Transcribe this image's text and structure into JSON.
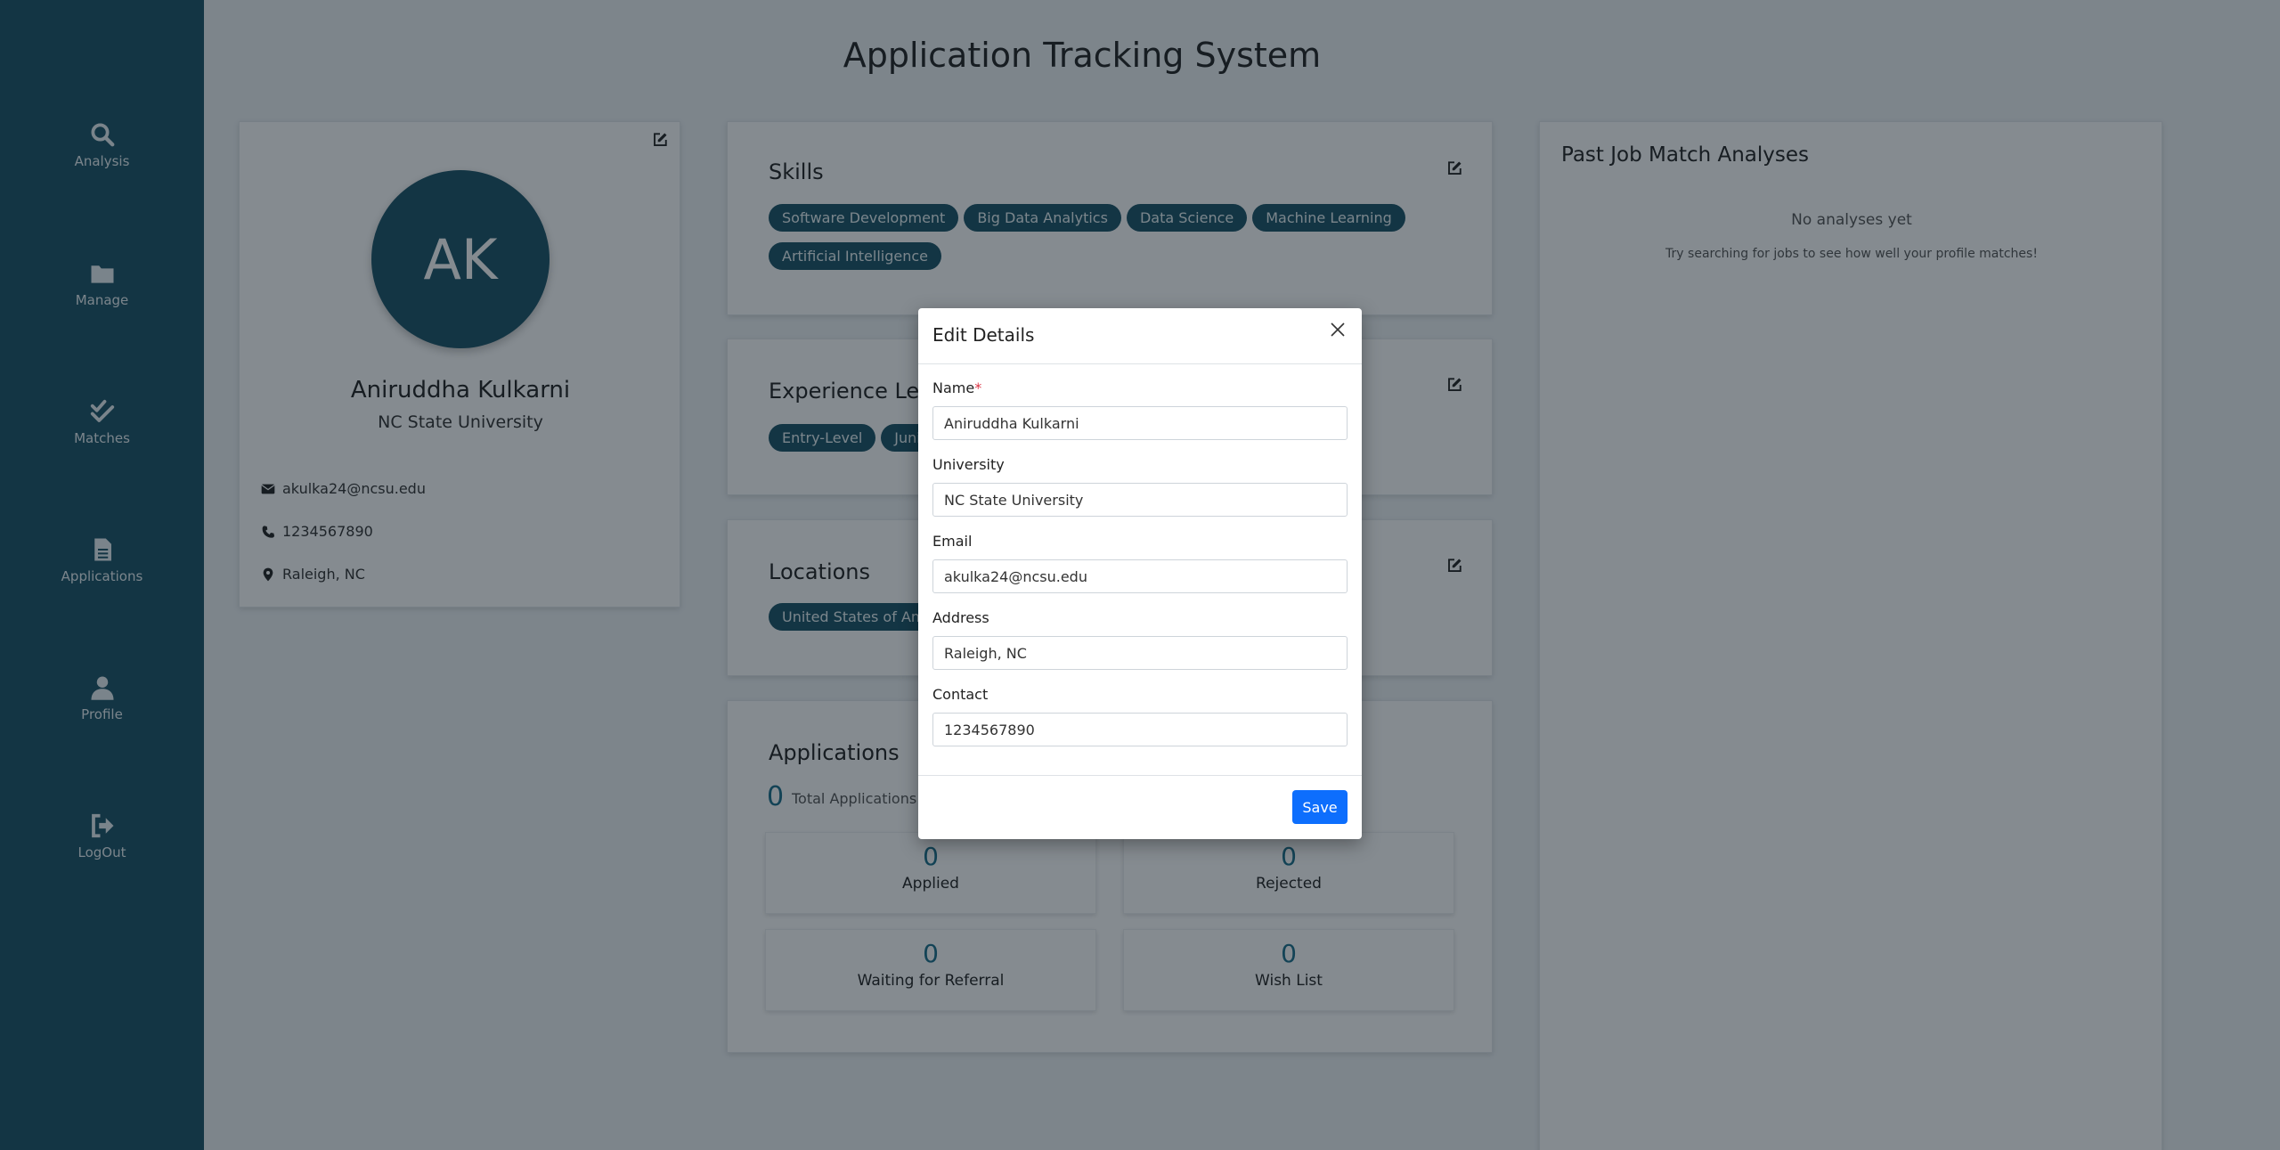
{
  "app_title": "Application Tracking System",
  "sidebar": {
    "items": [
      {
        "label": "Analysis",
        "icon": "search-icon"
      },
      {
        "label": "Manage",
        "icon": "folder-icon"
      },
      {
        "label": "Matches",
        "icon": "double-check-icon"
      },
      {
        "label": "Applications",
        "icon": "document-icon"
      },
      {
        "label": "Profile",
        "icon": "user-icon"
      },
      {
        "label": "LogOut",
        "icon": "logout-icon"
      }
    ]
  },
  "profile": {
    "initials": "AK",
    "name": "Aniruddha Kulkarni",
    "university": "NC State University",
    "email": "akulka24@ncsu.edu",
    "phone": "1234567890",
    "location": "Raleigh, NC"
  },
  "skills": {
    "title": "Skills",
    "items": [
      "Software Development",
      "Big Data Analytics",
      "Data Science",
      "Machine Learning",
      "Artificial Intelligence"
    ]
  },
  "experience": {
    "title": "Experience Level",
    "items": [
      "Entry-Level",
      "Junior-Level"
    ]
  },
  "locations": {
    "title": "Locations",
    "items": [
      "United States of America"
    ]
  },
  "applications": {
    "title": "Applications",
    "total": "0",
    "total_label": "Total Applications",
    "stats": [
      {
        "value": "0",
        "label": "Applied"
      },
      {
        "value": "0",
        "label": "Rejected"
      },
      {
        "value": "0",
        "label": "Waiting for Referral"
      },
      {
        "value": "0",
        "label": "Wish List"
      }
    ]
  },
  "past_analyses": {
    "title": "Past Job Match Analyses",
    "empty": "No analyses yet",
    "hint": "Try searching for jobs to see how well your profile matches!"
  },
  "modal": {
    "title": "Edit Details",
    "required_mark": "*",
    "fields": [
      {
        "label": "Name",
        "value": "Aniruddha Kulkarni"
      },
      {
        "label": "University",
        "value": "NC State University"
      },
      {
        "label": "Email",
        "value": "akulka24@ncsu.edu"
      },
      {
        "label": "Address",
        "value": "Raleigh, NC"
      },
      {
        "label": "Contact",
        "value": "1234567890"
      }
    ],
    "save_label": "Save"
  },
  "colors": {
    "sidebar": "#1b5266",
    "chip": "#1b5266",
    "accent_number": "#1b6f8a",
    "primary_button": "#0d6efd",
    "required": "#dc3545"
  }
}
